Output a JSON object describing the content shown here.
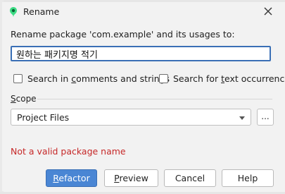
{
  "dialog": {
    "title": "Rename",
    "prompt": "Rename package 'com.example' and its usages to:",
    "new_name_value": "원하는 패키지명 적기",
    "options": {
      "search_comments": {
        "prefix": "Search in ",
        "mnemonic": "c",
        "suffix": "omments and strings",
        "checked": false
      },
      "search_text": {
        "prefix": "Search for ",
        "mnemonic": "t",
        "suffix": "ext occurrences",
        "checked": false
      }
    },
    "scope": {
      "label_mnemonic": "S",
      "label_rest": "cope",
      "selected": "Project Files",
      "browse_label": "..."
    },
    "error_message": "Not a valid package name",
    "buttons": {
      "refactor": {
        "mnemonic": "R",
        "rest": "efactor"
      },
      "preview": {
        "pre": "",
        "mnemonic": "P",
        "rest": "review"
      },
      "cancel": "Cancel",
      "help": "Help"
    }
  },
  "colors": {
    "primary_button": "#4a86d4",
    "input_focus_border": "#3a6fb5",
    "error_text": "#c62828",
    "app_icon": "#3ddc84"
  },
  "icons": {
    "app": "android-studio-icon",
    "close": "close-icon",
    "dropdown": "chevron-down-icon"
  }
}
